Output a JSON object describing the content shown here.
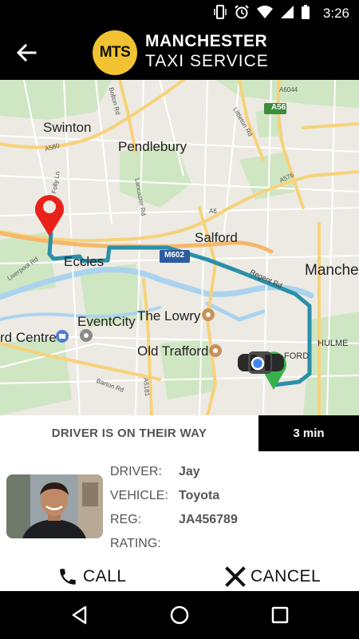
{
  "status_bar": {
    "time": "3:26",
    "icons": [
      "vibrate-icon",
      "alarm-icon",
      "wifi-icon",
      "signal-icon",
      "battery-icon"
    ]
  },
  "app_bar": {
    "logo_text": "MTS",
    "brand_line1": "MANCHESTER",
    "brand_line2": "TAXI SERVICE",
    "brand_color": "#f1c232"
  },
  "map": {
    "places": {
      "swinton": "Swinton",
      "pendlebury": "Pendlebury",
      "salford": "Salford",
      "eccles": "Eccles",
      "manchester": "Manche",
      "the_lowry": "The Lowry",
      "eventcity": "EventCity",
      "old_trafford": "Old Trafford",
      "trafford_centre": "rd Centre",
      "hulme": "HULME",
      "ford": "FORD"
    },
    "roads": {
      "a56": "A56",
      "a580": "A580",
      "m602": "M602",
      "regent_rd": "Regent Rd",
      "bolton_rd": "Bolton Rd",
      "lancaster_rd": "Lancaster Rd",
      "folly_ln": "Folly Ln",
      "littleton_rd": "Littleton Rd",
      "a6": "A6",
      "a576": "A576",
      "a6044": "A6044",
      "a5181": "A5181",
      "liverpool_rd": "Liverpool Rd",
      "barton_rd": "Barton Rd"
    },
    "route_color": "#2a8fa8",
    "origin_pin_color": "#e8221b",
    "destination_pin_color": "#39b14a"
  },
  "trip": {
    "status": "DRIVER IS ON THEIR WAY",
    "eta": "3 min"
  },
  "driver": {
    "driver_label": "DRIVER:",
    "driver_name": "Jay",
    "vehicle_label": "VEHICLE:",
    "vehicle": "Toyota",
    "reg_label": "REG:",
    "reg": "JA456789",
    "rating_label": "RATING:",
    "rating": ""
  },
  "actions": {
    "call": "CALL",
    "cancel": "CANCEL"
  }
}
